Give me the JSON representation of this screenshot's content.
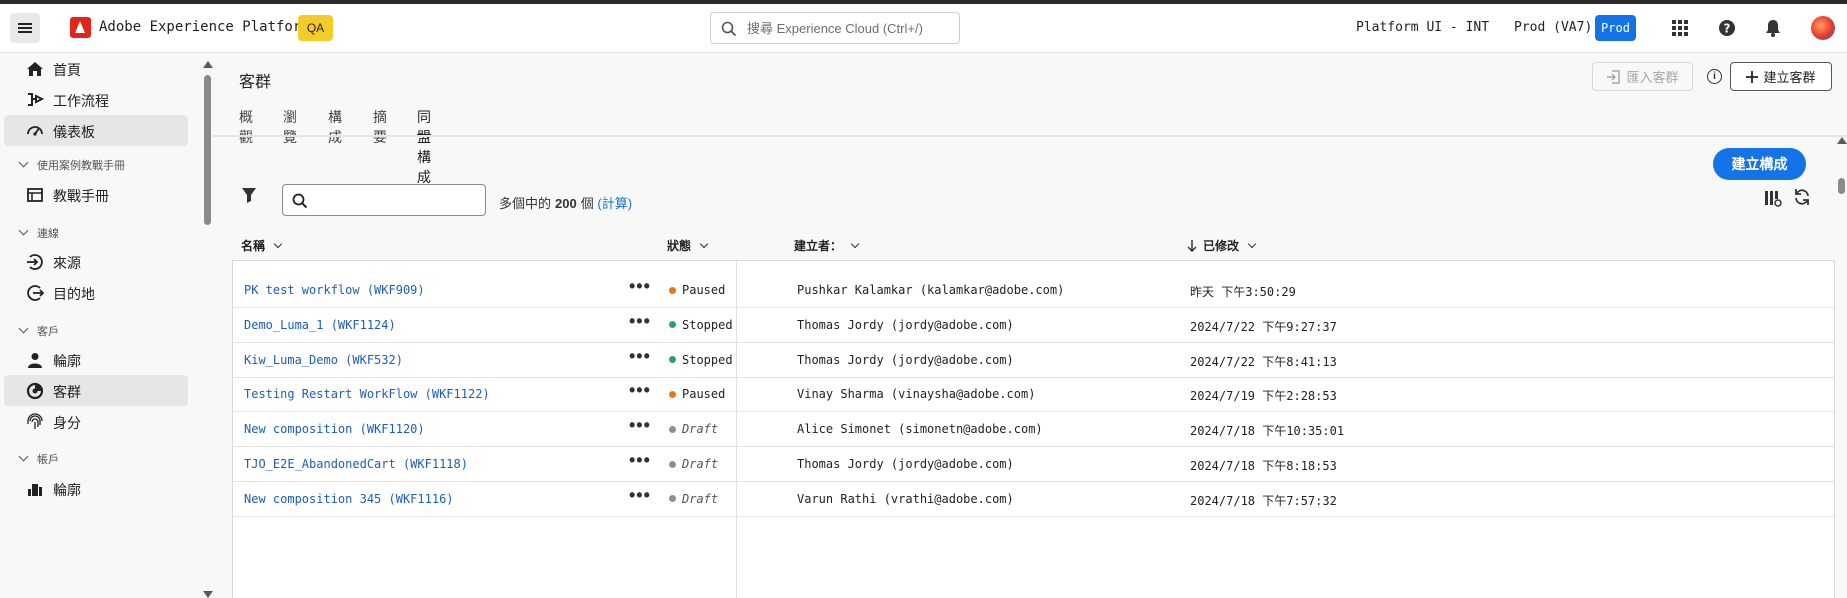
{
  "topbar": {
    "app_title": "Adobe Experience Platform",
    "env_badge": "QA",
    "search_placeholder": "搜尋 Experience Cloud (Ctrl+/)",
    "org_name": "Platform UI - INT",
    "sandbox_name": "Prod (VA7)",
    "sandbox_badge": "Prod"
  },
  "sidebar": {
    "items": [
      {
        "label": "首頁",
        "icon": "home-icon"
      },
      {
        "label": "工作流程",
        "icon": "workflow-icon"
      },
      {
        "label": "儀表板",
        "icon": "dashboard-icon"
      }
    ],
    "sections": [
      {
        "title": "使用案例教戰手冊",
        "items": [
          {
            "label": "教戰手冊",
            "icon": "playbook-icon"
          }
        ]
      },
      {
        "title": "連線",
        "items": [
          {
            "label": "來源",
            "icon": "source-icon"
          },
          {
            "label": "目的地",
            "icon": "destination-icon"
          }
        ]
      },
      {
        "title": "客戶",
        "items": [
          {
            "label": "輪廓",
            "icon": "profile-icon"
          },
          {
            "label": "客群",
            "icon": "audience-icon"
          },
          {
            "label": "身分",
            "icon": "identity-icon"
          }
        ]
      },
      {
        "title": "帳戶",
        "items": [
          {
            "label": "輪廓",
            "icon": "account-profile-icon"
          }
        ]
      }
    ]
  },
  "page": {
    "title": "客群",
    "tabs": [
      "概觀",
      "瀏覽",
      "構成",
      "摘要",
      "同盟構成"
    ],
    "active_tab": "同盟構成",
    "import_button": "匯入客群",
    "create_audience_button": "建立客群",
    "create_composition_button": "建立構成"
  },
  "toolbar": {
    "count_prefix": "多個中的",
    "count_value": "200",
    "count_suffix": "個",
    "count_link": "(計算)"
  },
  "table": {
    "headers": {
      "name": "名稱",
      "status": "狀態",
      "creator": "建立者：",
      "modified": "已修改"
    },
    "rows": [
      {
        "name": "PK test workflow (WKF909)",
        "status": "Paused",
        "creator": "Pushkar Kalamkar (kalamkar@adobe.com)",
        "modified": "昨天 下午3:50:29"
      },
      {
        "name": "Demo_Luma_1 (WKF1124)",
        "status": "Stopped",
        "creator": "Thomas Jordy (jordy@adobe.com)",
        "modified": "2024/7/22 下午9:27:37"
      },
      {
        "name": "Kiw_Luma_Demo (WKF532)",
        "status": "Stopped",
        "creator": "Thomas Jordy (jordy@adobe.com)",
        "modified": "2024/7/22 下午8:41:13"
      },
      {
        "name": "Testing Restart WorkFlow (WKF1122)",
        "status": "Paused",
        "creator": "Vinay Sharma (vinaysha@adobe.com)",
        "modified": "2024/7/19 下午2:28:53"
      },
      {
        "name": "New composition (WKF1120)",
        "status": "Draft",
        "creator": "Alice Simonet (simonetn@adobe.com)",
        "modified": "2024/7/18 下午10:35:01"
      },
      {
        "name": "TJO_E2E_AbandonedCart (WKF1118)",
        "status": "Draft",
        "creator": "Thomas Jordy (jordy@adobe.com)",
        "modified": "2024/7/18 下午8:18:53"
      },
      {
        "name": "New composition 345 (WKF1116)",
        "status": "Draft",
        "creator": "Varun Rathi (vrathi@adobe.com)",
        "modified": "2024/7/18 下午7:57:32"
      }
    ],
    "status_colors": {
      "Paused": "#e8741c",
      "Stopped": "#2d9d78",
      "Draft": "#8e8e8e"
    }
  }
}
